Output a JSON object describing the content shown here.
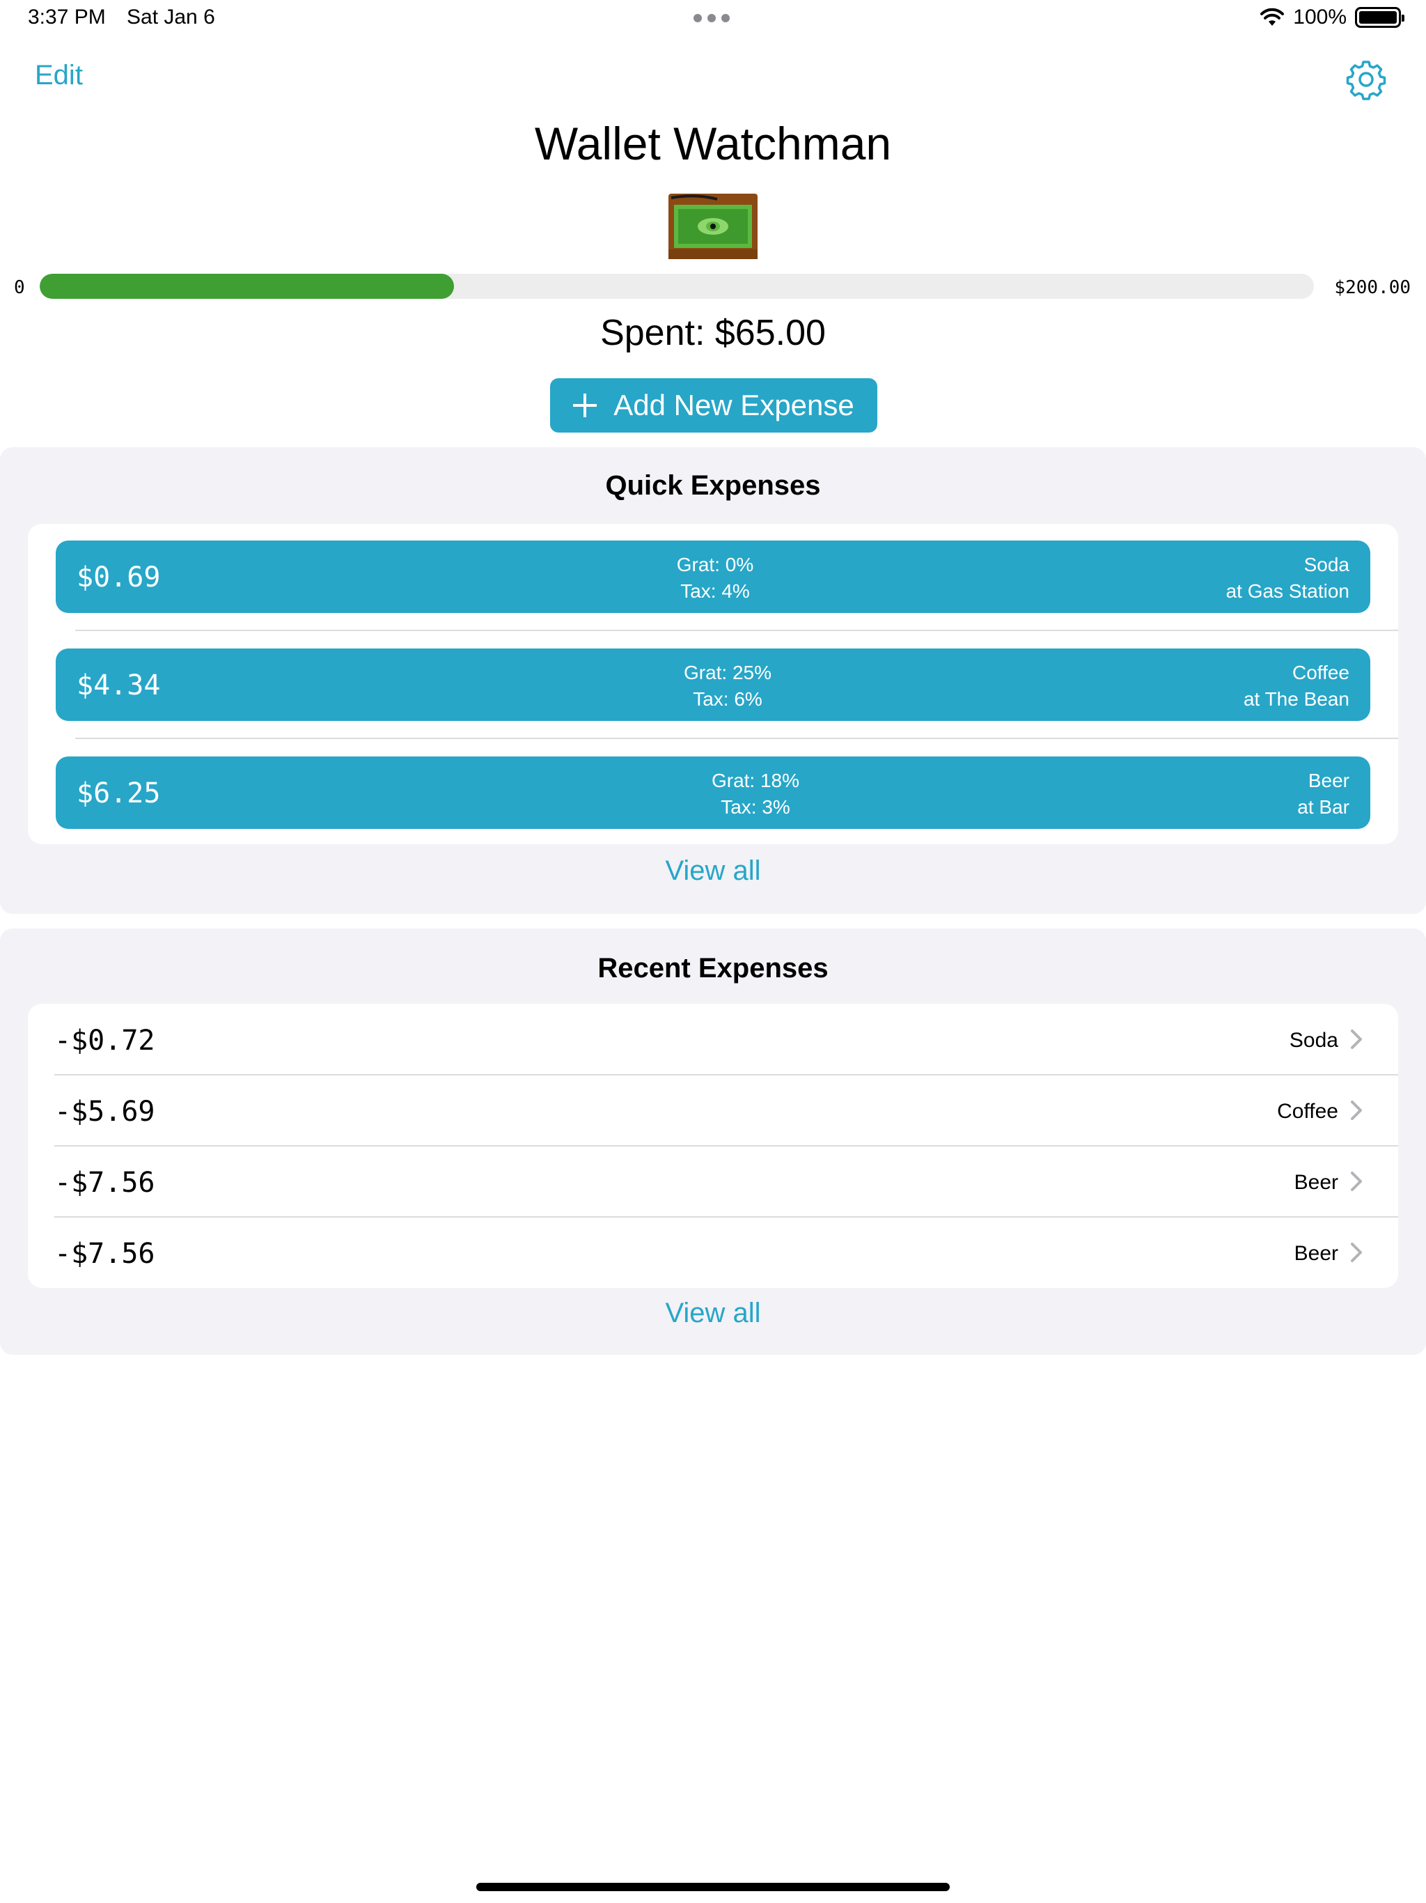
{
  "status_bar": {
    "time": "3:37 PM",
    "date": "Sat Jan 6",
    "battery": "100%",
    "battery_level": 1.0
  },
  "nav": {
    "edit_label": "Edit",
    "settings_icon": "gear-icon"
  },
  "app_title": "Wallet Watchman",
  "progress": {
    "min_label": "0",
    "max_label": "$200.00",
    "spent": 65,
    "max": 200,
    "fill_color": "#3f9f33"
  },
  "spent_label": "Spent: $65.00",
  "add_button": {
    "label": "Add New Expense",
    "icon": "plus-icon"
  },
  "quick_expenses": {
    "title": "Quick Expenses",
    "items": [
      {
        "amount": "$0.69",
        "grat": "Grat: 0%",
        "tax": "Tax: 4%",
        "name": "Soda",
        "place": "at Gas Station"
      },
      {
        "amount": "$4.34",
        "grat": "Grat: 25%",
        "tax": "Tax: 6%",
        "name": "Coffee",
        "place": "at The Bean"
      },
      {
        "amount": "$6.25",
        "grat": "Grat: 18%",
        "tax": "Tax: 3%",
        "name": "Beer",
        "place": "at Bar"
      }
    ],
    "view_all": "View all"
  },
  "recent_expenses": {
    "title": "Recent Expenses",
    "items": [
      {
        "amount": "-$0.72",
        "name": "Soda"
      },
      {
        "amount": "-$5.69",
        "name": "Coffee"
      },
      {
        "amount": "-$7.56",
        "name": "Beer"
      },
      {
        "amount": "-$7.56",
        "name": "Beer"
      }
    ],
    "view_all": "View all"
  },
  "colors": {
    "accent": "#27a6c8",
    "progress": "#3f9f33",
    "section_bg": "#f2f2f7"
  }
}
